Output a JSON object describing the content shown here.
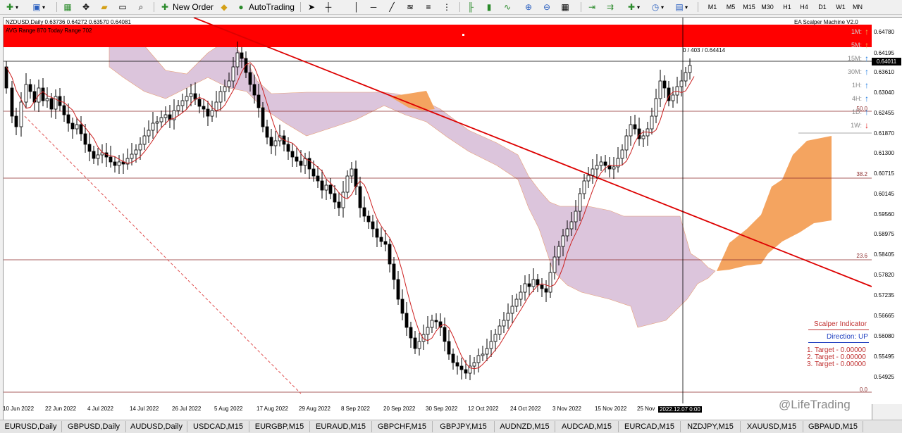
{
  "toolbar": {
    "new_order_label": "New Order",
    "autotrading_label": "AutoTrading",
    "timeframes": [
      "M1",
      "M5",
      "M15",
      "M30",
      "H1",
      "H4",
      "D1",
      "W1",
      "MN"
    ]
  },
  "chart": {
    "symbol_line": "NZDUSD,Daily  0.63736 0.64272 0.63570 0.64081",
    "avg_range_line": "AVG Range 870   Today Range 702",
    "ea_title": "EA Scalper Machine V2.0",
    "crosshair_readout": "0 / 403 / 0.64414",
    "crosshair_date": "2022.12.07 0:00",
    "current_price": "0.64011",
    "watermark": "@LifeTrading"
  },
  "price_axis": [
    "0.64780",
    "0.64195",
    "0.63610",
    "0.63040",
    "0.62455",
    "0.61870",
    "0.61300",
    "0.60715",
    "0.60145",
    "0.59560",
    "0.58975",
    "0.58405",
    "0.57820",
    "0.57235",
    "0.56665",
    "0.56080",
    "0.55495",
    "0.54925"
  ],
  "fib_levels": [
    "50.0",
    "38.2",
    "23.6",
    "0.0"
  ],
  "trend_panel": [
    {
      "tf": "1M:",
      "dir": "up",
      "faded": true
    },
    {
      "tf": "5M:",
      "dir": "up",
      "faded": true
    },
    {
      "tf": "15M:",
      "dir": "up",
      "faded": false
    },
    {
      "tf": "30M:",
      "dir": "up",
      "faded": false
    },
    {
      "tf": "1H:",
      "dir": "up",
      "faded": false
    },
    {
      "tf": "4H:",
      "dir": "up",
      "faded": false
    },
    {
      "tf": "1D:",
      "dir": "up",
      "faded": false
    },
    {
      "tf": "1W:",
      "dir": "down",
      "faded": false
    }
  ],
  "scalper": {
    "title": "Scalper Indicator",
    "direction": "Direction: UP",
    "targets": [
      "1. Target - 0.00000",
      "2. Target - 0.00000",
      "3. Target - 0.00000"
    ]
  },
  "date_axis": [
    "10 Jun 2022",
    "22 Jun 2022",
    "4 Jul 2022",
    "14 Jul 2022",
    "26 Jul 2022",
    "5 Aug 2022",
    "17 Aug 2022",
    "29 Aug 2022",
    "8 Sep 2022",
    "20 Sep 2022",
    "30 Sep 2022",
    "12 Oct 2022",
    "24 Oct 2022",
    "3 Nov 2022",
    "15 Nov 2022",
    "25 Nov"
  ],
  "tabs": [
    "EURUSD,Daily",
    "GBPUSD,Daily",
    "AUDUSD,Daily",
    "USDCAD,M15",
    "EURGBP,M15",
    "EURAUD,M15",
    "GBPCHF,M15",
    "GBPJPY,M15",
    "AUDNZD,M15",
    "AUDCAD,M15",
    "EURCAD,M15",
    "NZDJPY,M15",
    "XAUUSD,M15",
    "GBPAUD,M15"
  ],
  "colors": {
    "red_band": "#ff0000",
    "cloud": "#d8bfd8",
    "cloud_orange": "#f4a460",
    "candle": "#000000",
    "trend_line": "#dd0000",
    "fib_line": "#8b2a2a",
    "up_arrow": "#1e7ce0",
    "down_arrow": "#e02020"
  }
}
